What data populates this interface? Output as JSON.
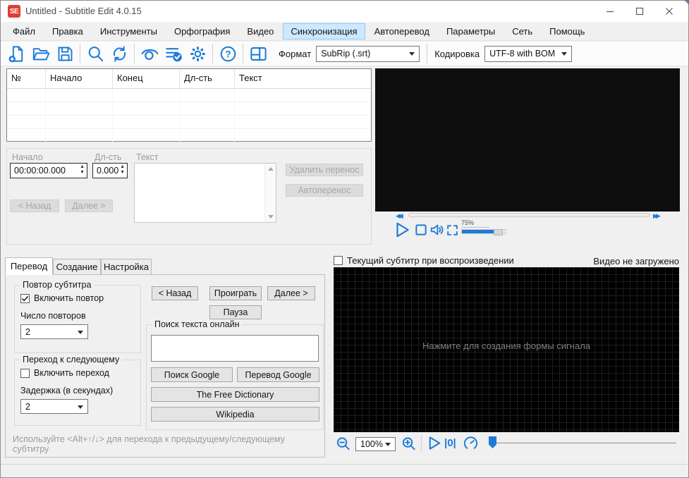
{
  "window": {
    "title": "Untitled - Subtitle Edit 4.0.15",
    "logo_text": "SE"
  },
  "menu": {
    "items": [
      "Файл",
      "Правка",
      "Инструменты",
      "Орфография",
      "Видео",
      "Синхронизация",
      "Автоперевод",
      "Параметры",
      "Сеть",
      "Помощь"
    ],
    "active_item": "Синхронизация"
  },
  "toolbar": {
    "format_label": "Формат",
    "format_value": "SubRip (.srt)",
    "encoding_label": "Кодировка",
    "encoding_value": "UTF-8 with BOM"
  },
  "subtitle_list": {
    "columns": [
      "№",
      "Начало",
      "Конец",
      "Дл-сть",
      "Текст"
    ],
    "rows": []
  },
  "editor": {
    "start_label": "Начало",
    "start_value": "00:00:00.000",
    "duration_label": "Дл-сть",
    "duration_value": "0.000",
    "text_label": "Текст",
    "text_value": "",
    "remove_line_break_button": "Удалить перенос",
    "auto_break_button": "Автоперенос",
    "back_button": "< Назад",
    "next_button": "Далее >"
  },
  "video_player": {
    "volume_percent": "75%"
  },
  "bottom_left": {
    "tabs": [
      "Перевод",
      "Создание",
      "Настройка"
    ],
    "active_tab": "Перевод",
    "repeat_group": {
      "title": "Повтор субтитра",
      "checkbox_label": "Включить повтор",
      "checked": true,
      "count_label": "Число повторов",
      "count_value": "2"
    },
    "advance_group": {
      "title": "Переход к следующему",
      "checkbox_label": "Включить переход",
      "checked": false,
      "delay_label": "Задержка (в секундах)",
      "delay_value": "2"
    },
    "buttons": {
      "back": "< Назад",
      "play": "Проиграть",
      "next": "Далее >",
      "pause": "Пауза"
    },
    "search_group": {
      "title": "Поиск текста онлайн",
      "input_value": "",
      "buttons": [
        "Поиск Google",
        "Перевод Google",
        "The Free Dictionary",
        "Wikipedia"
      ]
    },
    "hint": "Используйте <Alt+↑/↓> для перехода к предыдущему/следующему субтитру"
  },
  "bottom_right": {
    "show_subtitle_checkbox_label": "Текущий субтитр при воспроизведении",
    "show_subtitle_checked": false,
    "video_status": "Видео не загружено",
    "waveform_hint": "Нажмите для создания формы сигнала",
    "zoom_value": "100%",
    "position_zero_label": "|0|"
  },
  "colors": {
    "accent_blue": "#1d7ad9",
    "logo_red": "#e13d33",
    "menu_highlight_bg": "#cde8ff",
    "menu_highlight_border": "#90c8f6",
    "waveform_bg": "#000000"
  }
}
